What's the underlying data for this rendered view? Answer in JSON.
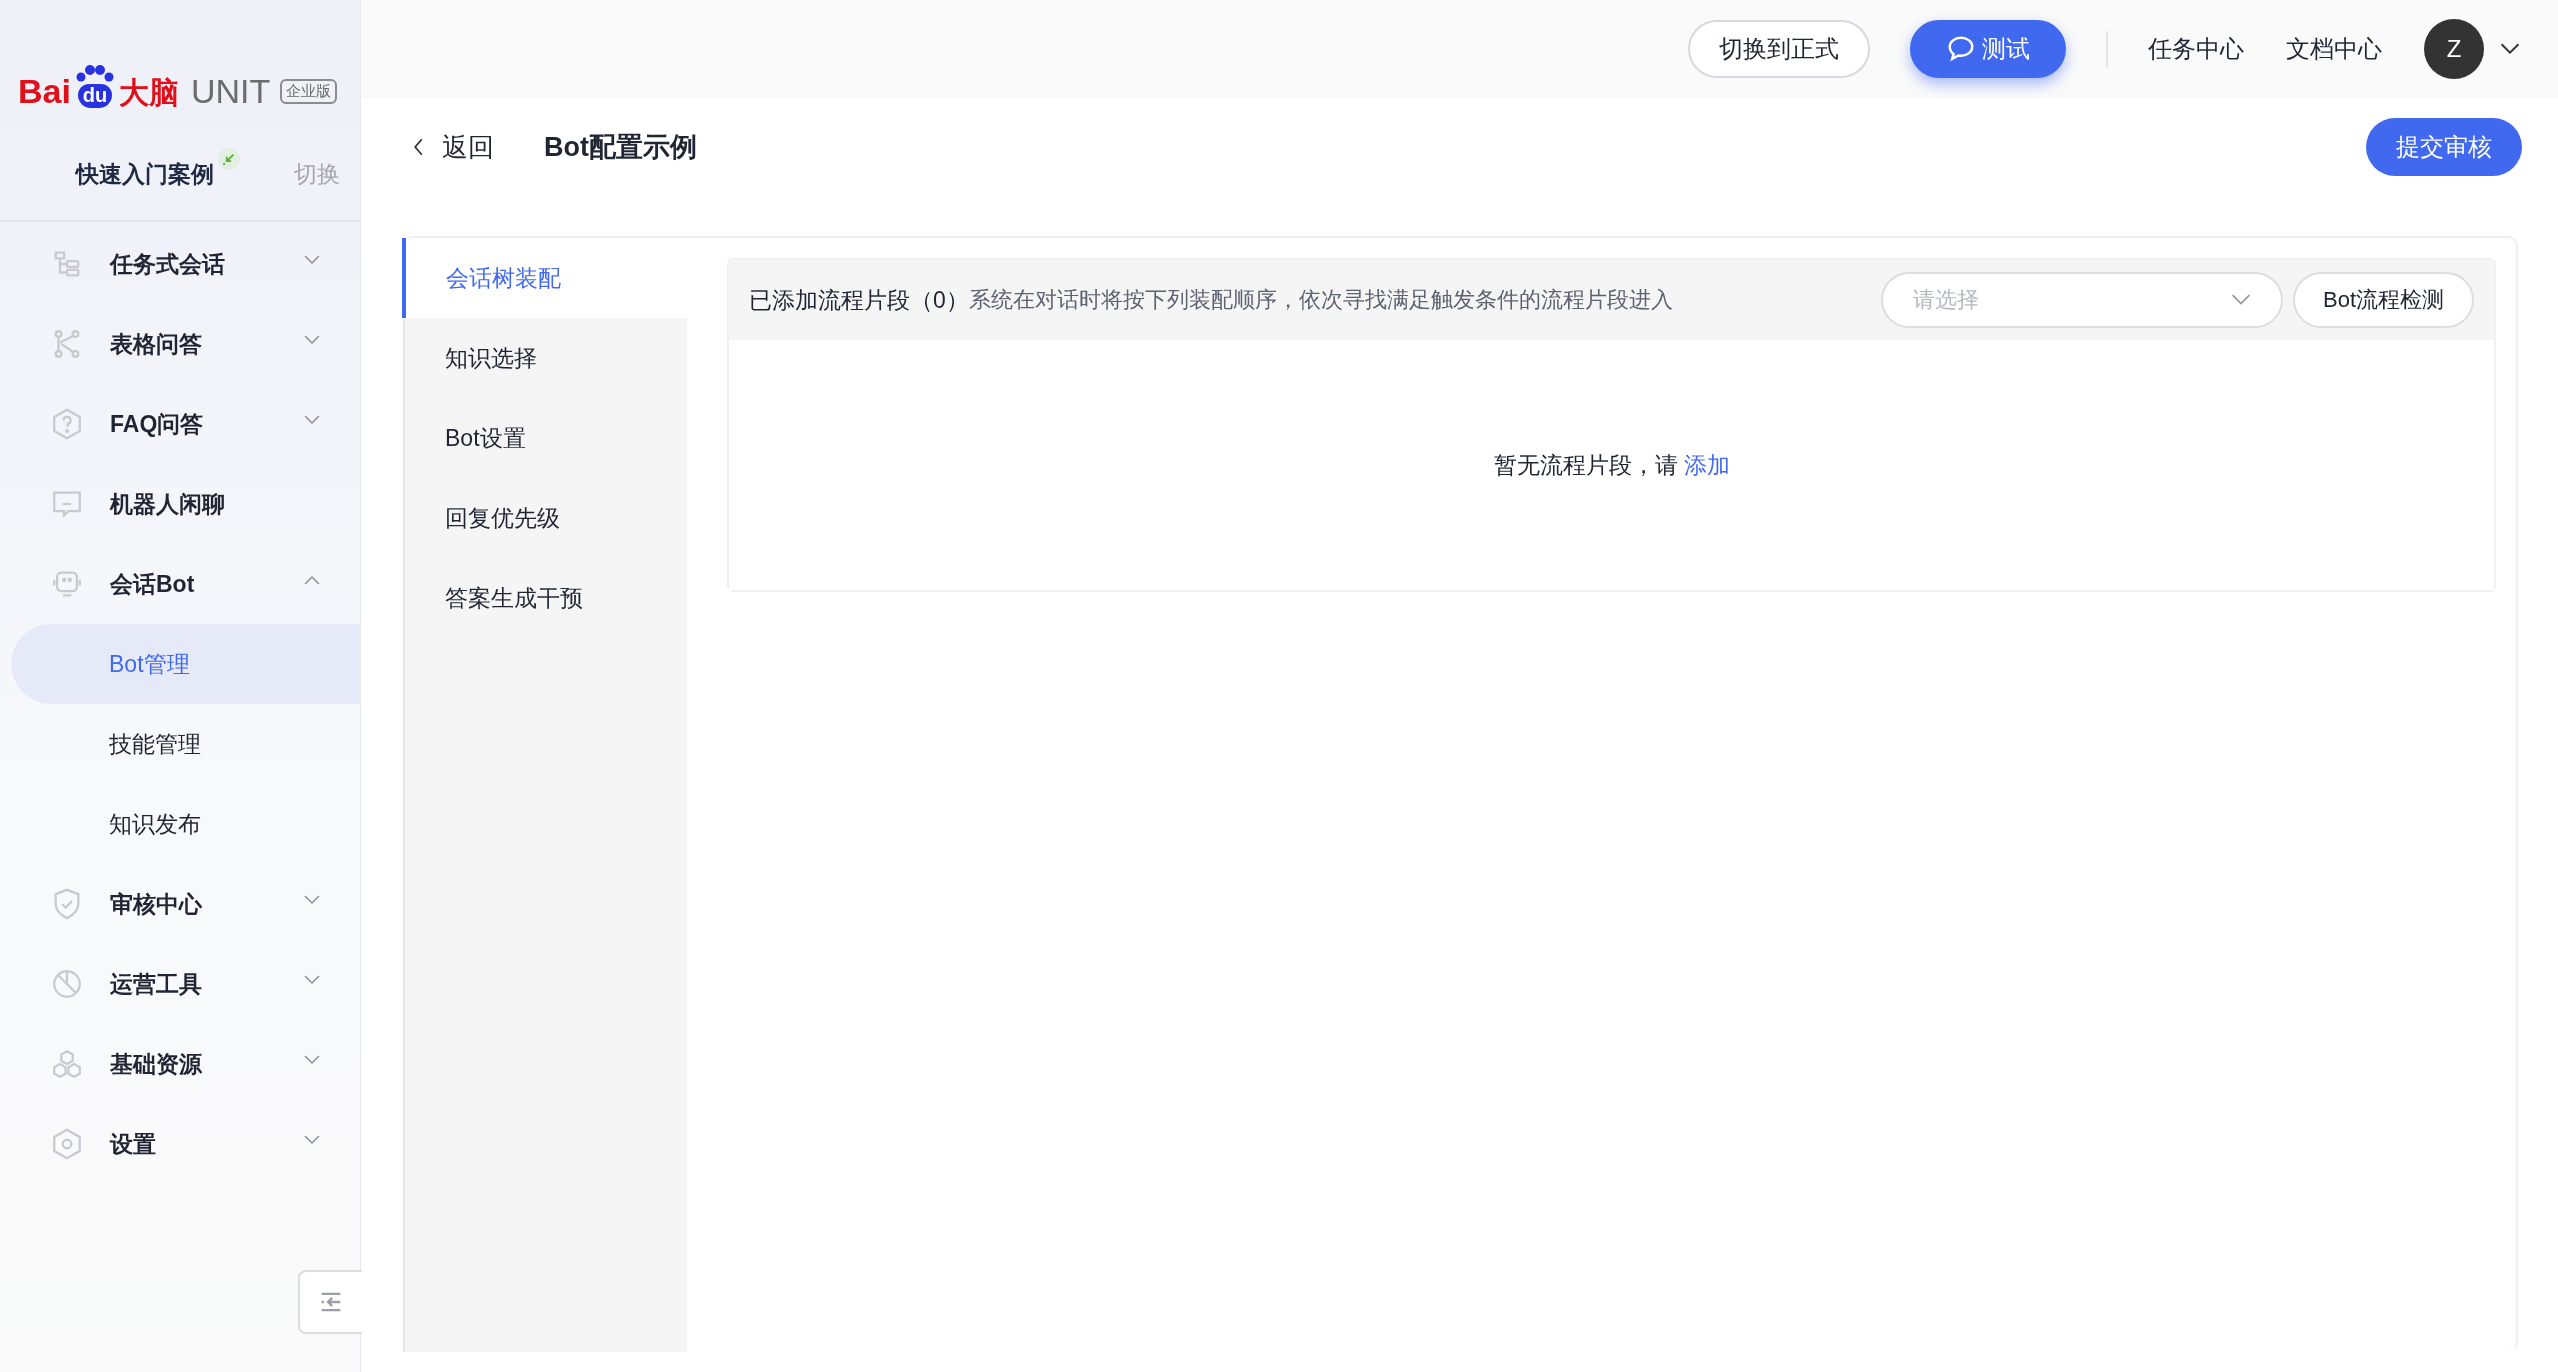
{
  "logo": {
    "brand_left": "Bai",
    "brand_paw": "du",
    "brand_cn": "大脑",
    "product": "UNIT",
    "edition": "企业版"
  },
  "project": {
    "name": "快速入门案例",
    "switch": "切换"
  },
  "nav": [
    {
      "label": "任务式会话",
      "expanded": false
    },
    {
      "label": "表格问答",
      "expanded": false
    },
    {
      "label": "FAQ问答",
      "expanded": false
    },
    {
      "label": "机器人闲聊"
    },
    {
      "label": "会话Bot",
      "expanded": true,
      "children": [
        {
          "label": "Bot管理",
          "selected": true
        },
        {
          "label": "技能管理",
          "selected": false
        },
        {
          "label": "知识发布",
          "selected": false
        }
      ]
    },
    {
      "label": "审核中心",
      "expanded": false
    },
    {
      "label": "运营工具",
      "expanded": false
    },
    {
      "label": "基础资源",
      "expanded": false
    },
    {
      "label": "设置",
      "expanded": false
    }
  ],
  "topbar": {
    "switch_button": "切换到正式",
    "test_button": "测试",
    "links": [
      "任务中心",
      "文档中心"
    ],
    "avatar": "Z"
  },
  "page": {
    "back": "返回",
    "title": "Bot配置示例",
    "submit": "提交审核"
  },
  "tabs": [
    {
      "label": "会话树装配",
      "selected": true
    },
    {
      "label": "知识选择",
      "selected": false
    },
    {
      "label": "Bot设置",
      "selected": false
    },
    {
      "label": "回复优先级",
      "selected": false
    },
    {
      "label": "答案生成干预",
      "selected": false
    }
  ],
  "panel": {
    "title": "已添加流程片段（0）",
    "description": "系统在对话时将按下列装配顺序，依次寻找满足触发条件的流程片段进入",
    "select": {
      "placeholder": "请选择"
    },
    "check_button": "Bot流程检测",
    "empty_text": "暂无流程片段，请",
    "empty_link": "添加"
  }
}
